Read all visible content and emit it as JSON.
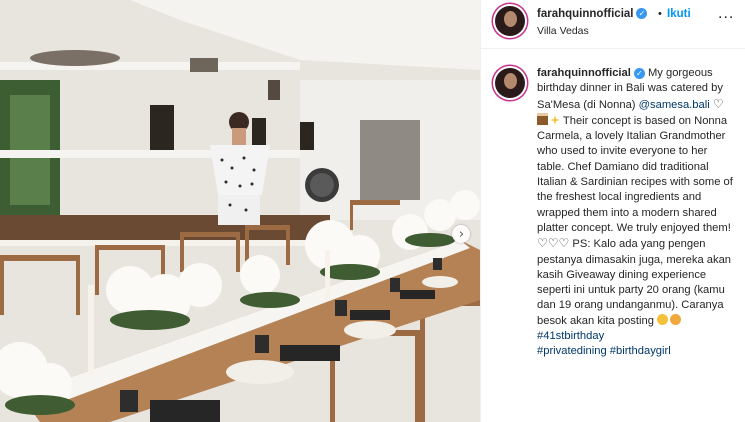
{
  "post": {
    "username": "farahquinnofficial",
    "separator": "•",
    "follow_label": "Ikuti",
    "location": "Villa Vedas",
    "more_label": "..."
  },
  "caption": {
    "username": "farahquinnofficial",
    "text_1": " My gorgeous birthday dinner in Bali was catered by Sa'Mesa (di Nonna) ",
    "mention": "@samesa.bali",
    "text_2": " Their concept is based on Nonna Carmela, a lovely Italian Grandmother who used to invite everyone to her table. Chef Damiano did traditional Italian & Sardinian recipes with some of the freshest local ingredients and wrapped them into a modern shared platter concept. We truly enjoyed them! ",
    "text_3": " PS: Kalo ada yang pengen pestanya dimasakin juga, mereka akan kasih Giveaway dining experience seperti ini untuk party 20 orang (kamu dan 19 orang undanganmu). Caranya besok akan kita posting ",
    "hashtags": [
      "#41stbirthday",
      "#privatedining",
      "#birthdaygirl"
    ]
  },
  "icons": {
    "heart": "♡",
    "verified": "✓",
    "next": "›"
  },
  "colors": {
    "link_blue": "#0095f6",
    "hashtag_blue": "#00376b",
    "verified_blue": "#3897f0",
    "text": "#262626"
  }
}
